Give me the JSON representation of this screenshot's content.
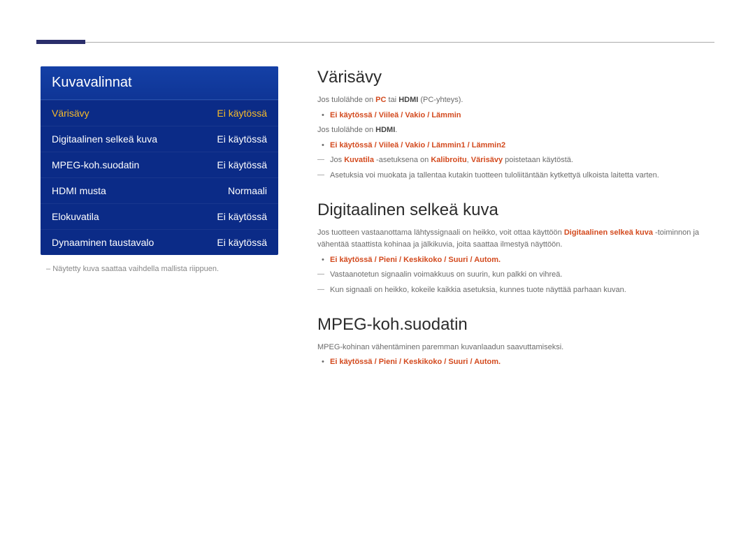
{
  "menu": {
    "title": "Kuvavalinnat",
    "rows": [
      {
        "label": "Värisävy",
        "value": "Ei käytössä",
        "selected": true
      },
      {
        "label": "Digitaalinen selkeä kuva",
        "value": "Ei käytössä",
        "selected": false
      },
      {
        "label": "MPEG-koh.suodatin",
        "value": "Ei käytössä",
        "selected": false
      },
      {
        "label": "HDMI musta",
        "value": "Normaali",
        "selected": false
      },
      {
        "label": "Elokuvatila",
        "value": "Ei käytössä",
        "selected": false
      },
      {
        "label": "Dynaaminen taustavalo",
        "value": "Ei käytössä",
        "selected": false
      }
    ]
  },
  "caption": "Näytetty kuva saattaa vaihdella mallista riippuen.",
  "sections": {
    "varisavy": {
      "heading": "Värisävy",
      "line1_pre": "Jos tulolähde on ",
      "line1_pc": "PC",
      "line1_mid": " tai ",
      "line1_hdmi": "HDMI",
      "line1_post": " (PC-yhteys).",
      "opts1": "Ei käytössä / Viileä / Vakio / Lämmin",
      "line2_pre": "Jos tulolähde on ",
      "line2_hdmi": "HDMI",
      "line2_post": ".",
      "opts2": "Ei käytössä / Viileä / Vakio / Lämmin1 / Lämmin2",
      "note1_pre": "Jos ",
      "note1_kuvatila": "Kuvatila",
      "note1_mid1": " -asetuksena on ",
      "note1_kalib": "Kalibroitu",
      "note1_mid2": ", ",
      "note1_varis": "Värisävy",
      "note1_post": " poistetaan käytöstä.",
      "note2": "Asetuksia voi muokata ja tallentaa kutakin tuotteen tuloliitäntään kytkettyä ulkoista laitetta varten."
    },
    "digitaalinen": {
      "heading": "Digitaalinen selkeä kuva",
      "intro_pre": "Jos tuotteen vastaanottama lähtyssignaali on heikko, voit ottaa käyttöön ",
      "intro_bold": "Digitaalinen selkeä kuva",
      "intro_post": " -toiminnon ja vähentää staattista kohinaa ja jälkikuvia, joita saattaa ilmestyä näyttöön.",
      "opts": "Ei käytössä / Pieni / Keskikoko / Suuri / Autom.",
      "note1": "Vastaanotetun signaalin voimakkuus on suurin, kun palkki on vihreä.",
      "note2": "Kun signaali on heikko, kokeile kaikkia asetuksia, kunnes tuote näyttää parhaan kuvan."
    },
    "mpeg": {
      "heading": "MPEG-koh.suodatin",
      "intro": "MPEG-kohinan vähentäminen paremman kuvanlaadun saavuttamiseksi.",
      "opts": "Ei käytössä / Pieni / Keskikoko / Suuri / Autom."
    }
  }
}
